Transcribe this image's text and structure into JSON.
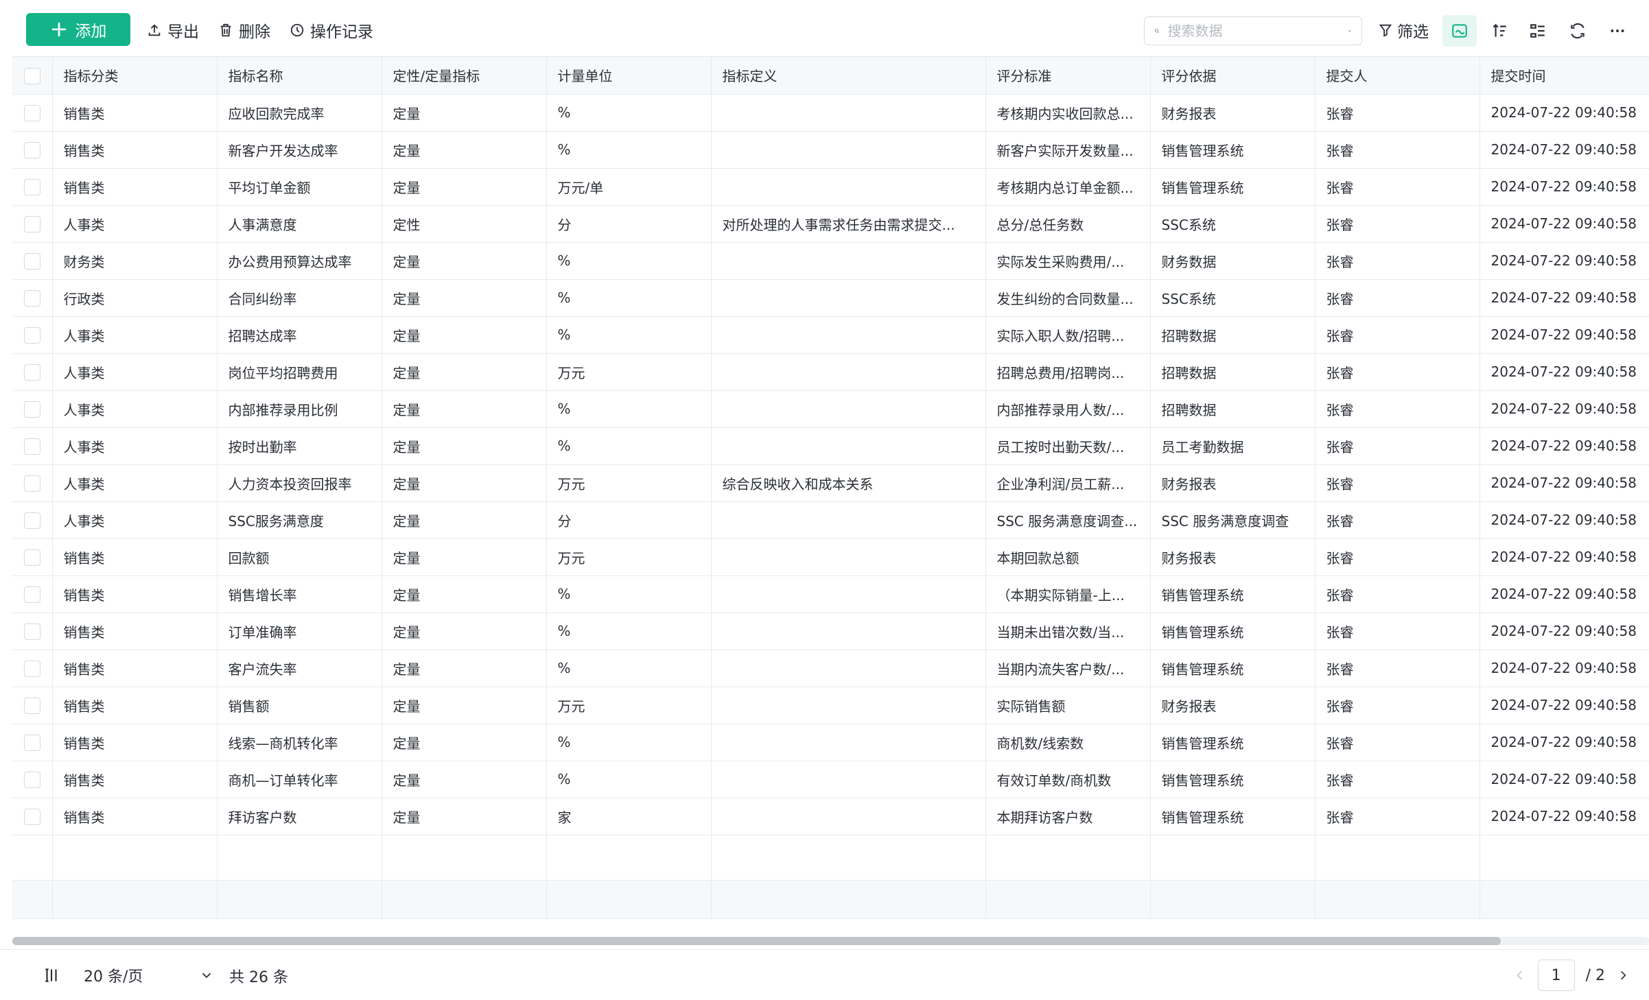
{
  "toolbar": {
    "add_label": "添加",
    "export_label": "导出",
    "delete_label": "删除",
    "history_label": "操作记录",
    "search_placeholder": "搜索数据",
    "filter_label": "筛选"
  },
  "columns": [
    "指标分类",
    "指标名称",
    "定性/定量指标",
    "计量单位",
    "指标定义",
    "评分标准",
    "评分依据",
    "提交人",
    "提交时间"
  ],
  "rows": [
    [
      "销售类",
      "应收回款完成率",
      "定量",
      "%",
      "",
      "考核期内实收回款总...",
      "财务报表",
      "张睿",
      "2024-07-22 09:40:58"
    ],
    [
      "销售类",
      "新客户开发达成率",
      "定量",
      "%",
      "",
      "新客户实际开发数量...",
      "销售管理系统",
      "张睿",
      "2024-07-22 09:40:58"
    ],
    [
      "销售类",
      "平均订单金额",
      "定量",
      "万元/单",
      "",
      "考核期内总订单金额...",
      "销售管理系统",
      "张睿",
      "2024-07-22 09:40:58"
    ],
    [
      "人事类",
      "人事满意度",
      "定性",
      "分",
      "对所处理的人事需求任务由需求提交...",
      "总分/总任务数",
      "SSC系统",
      "张睿",
      "2024-07-22 09:40:58"
    ],
    [
      "财务类",
      "办公费用预算达成率",
      "定量",
      "%",
      "",
      "实际发生采购费用/...",
      "财务数据",
      "张睿",
      "2024-07-22 09:40:58"
    ],
    [
      "行政类",
      "合同纠纷率",
      "定量",
      "%",
      "",
      "发生纠纷的合同数量...",
      "SSC系统",
      "张睿",
      "2024-07-22 09:40:58"
    ],
    [
      "人事类",
      "招聘达成率",
      "定量",
      "%",
      "",
      "实际入职人数/招聘...",
      "招聘数据",
      "张睿",
      "2024-07-22 09:40:58"
    ],
    [
      "人事类",
      "岗位平均招聘费用",
      "定量",
      "万元",
      "",
      "招聘总费用/招聘岗...",
      "招聘数据",
      "张睿",
      "2024-07-22 09:40:58"
    ],
    [
      "人事类",
      "内部推荐录用比例",
      "定量",
      "%",
      "",
      "内部推荐录用人数/...",
      "招聘数据",
      "张睿",
      "2024-07-22 09:40:58"
    ],
    [
      "人事类",
      "按时出勤率",
      "定量",
      "%",
      "",
      "员工按时出勤天数/...",
      "员工考勤数据",
      "张睿",
      "2024-07-22 09:40:58"
    ],
    [
      "人事类",
      "人力资本投资回报率",
      "定量",
      "万元",
      "综合反映收入和成本关系",
      "企业净利润/员工薪...",
      "财务报表",
      "张睿",
      "2024-07-22 09:40:58"
    ],
    [
      "人事类",
      "SSC服务满意度",
      "定量",
      "分",
      "",
      "SSC 服务满意度调查...",
      "SSC 服务满意度调查",
      "张睿",
      "2024-07-22 09:40:58"
    ],
    [
      "销售类",
      "回款额",
      "定量",
      "万元",
      "",
      "本期回款总额",
      "财务报表",
      "张睿",
      "2024-07-22 09:40:58"
    ],
    [
      "销售类",
      "销售增长率",
      "定量",
      "%",
      "",
      "（本期实际销量-上...",
      "销售管理系统",
      "张睿",
      "2024-07-22 09:40:58"
    ],
    [
      "销售类",
      "订单准确率",
      "定量",
      "%",
      "",
      "当期未出错次数/当...",
      "销售管理系统",
      "张睿",
      "2024-07-22 09:40:58"
    ],
    [
      "销售类",
      "客户流失率",
      "定量",
      "%",
      "",
      "当期内流失客户数/...",
      "销售管理系统",
      "张睿",
      "2024-07-22 09:40:58"
    ],
    [
      "销售类",
      "销售额",
      "定量",
      "万元",
      "",
      "实际销售额",
      "财务报表",
      "张睿",
      "2024-07-22 09:40:58"
    ],
    [
      "销售类",
      "线索—商机转化率",
      "定量",
      "%",
      "",
      "商机数/线索数",
      "销售管理系统",
      "张睿",
      "2024-07-22 09:40:58"
    ],
    [
      "销售类",
      "商机—订单转化率",
      "定量",
      "%",
      "",
      "有效订单数/商机数",
      "销售管理系统",
      "张睿",
      "2024-07-22 09:40:58"
    ],
    [
      "销售类",
      "拜访客户数",
      "定量",
      "家",
      "",
      "本期拜访客户数",
      "销售管理系统",
      "张睿",
      "2024-07-22 09:40:58"
    ]
  ],
  "footer": {
    "page_size": "20 条/页",
    "total": "共 26 条",
    "current_page": "1",
    "total_pages": "/ 2"
  },
  "colors": {
    "primary": "#14b38a",
    "header_bg": "#f7f8fa",
    "border": "#e8eaed"
  }
}
